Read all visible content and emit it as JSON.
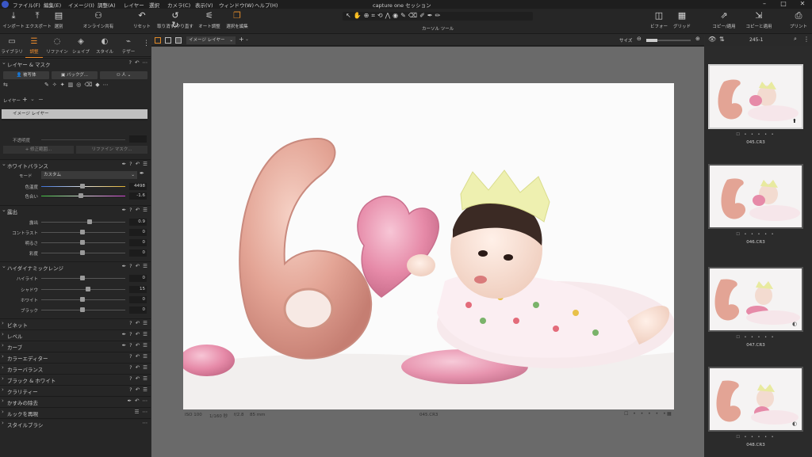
{
  "menubar": {
    "items": [
      "ファイル(F)",
      "編集(E)",
      "イメージ(I)",
      "調整(A)",
      "レイヤー",
      "選択",
      "カメラ(C)",
      "表示(V)",
      "ウィンドウ(W)",
      "ヘルプ(H)"
    ],
    "window_title": "capture one セッション"
  },
  "toolbar": {
    "left": [
      {
        "label": "インポート",
        "icon": "import-icon"
      },
      {
        "label": "エクスポート",
        "icon": "export-icon"
      },
      {
        "label": "選別",
        "icon": "cull-icon"
      },
      {
        "label": "オンライン共有",
        "icon": "share-icon"
      },
      {
        "label": "リセット",
        "icon": "reset-icon"
      },
      {
        "label": "取り消す/やり直す",
        "icon": "undo-icon"
      },
      {
        "label": "オート調整",
        "icon": "auto-adjust-icon"
      },
      {
        "label": "選択を編集",
        "icon": "edit-selection-icon"
      }
    ],
    "cursor_tools_label": "カーソル ツール",
    "right": [
      {
        "label": "ビフォー",
        "icon": "before-icon"
      },
      {
        "label": "グリッド",
        "icon": "grid-icon"
      },
      {
        "label": "コピー/適用",
        "icon": "copy-apply-icon"
      },
      {
        "label": "コピーと適用",
        "icon": "copy-and-apply-icon"
      },
      {
        "label": "プリント",
        "icon": "print-icon"
      }
    ]
  },
  "tabs": [
    {
      "label": "ライブラリ",
      "icon": "library-icon"
    },
    {
      "label": "調整",
      "icon": "adjust-icon"
    },
    {
      "label": "リファイン",
      "icon": "refine-icon"
    },
    {
      "label": "シェイプ",
      "icon": "shape-icon"
    },
    {
      "label": "スタイル",
      "icon": "style-icon"
    },
    {
      "label": "テザー",
      "icon": "tether-icon"
    }
  ],
  "layers": {
    "title": "レイヤー & マスク",
    "subject_btn": "被写体",
    "background_btn": "バックグ...",
    "people_btn": "人",
    "layer_label": "レイヤー",
    "layer_item": "イメージ レイヤー",
    "opacity_label": "不透明度",
    "refine_range_btn": "修正範囲...",
    "refine_mask_btn": "リファイン マスク..."
  },
  "white_balance": {
    "title": "ホワイトバランス",
    "mode_label": "モード",
    "mode_value": "カスタム",
    "sliders": [
      {
        "label": "色温度",
        "value": "4498",
        "pos": 0.49
      },
      {
        "label": "色合い",
        "value": "-1.6",
        "pos": 0.47
      }
    ]
  },
  "exposure": {
    "title": "露出",
    "sliders": [
      {
        "label": "露出",
        "value": "0.9",
        "pos": 0.58
      },
      {
        "label": "コントラスト",
        "value": "0",
        "pos": 0.49
      },
      {
        "label": "明るさ",
        "value": "0",
        "pos": 0.49
      },
      {
        "label": "彩度",
        "value": "0",
        "pos": 0.49
      }
    ]
  },
  "hdr": {
    "title": "ハイダイナミックレンジ",
    "sliders": [
      {
        "label": "ハイライト",
        "value": "0",
        "pos": 0.49
      },
      {
        "label": "シャドウ",
        "value": "15",
        "pos": 0.56
      },
      {
        "label": "ホワイト",
        "value": "0",
        "pos": 0.49
      },
      {
        "label": "ブラック",
        "value": "0",
        "pos": 0.49
      }
    ]
  },
  "collapsed_sections": [
    "ビネット",
    "レベル",
    "カーブ",
    "カラーエディター",
    "カラーバランス",
    "ブラック & ホワイト",
    "クラリティー",
    "かすみの除去",
    "ルックを再現",
    "スタイルブラシ"
  ],
  "viewer": {
    "layer_dropdown": "イメージ レイヤー",
    "size_label": "サイズ",
    "iso": "ISO 100",
    "shutter": "1/160 秒",
    "aperture": "f/2.8",
    "focal": "85 mm",
    "filename": "045.CR3"
  },
  "browser": {
    "count": "245-1",
    "thumbs": [
      "045.CR3",
      "046.CR3",
      "047.CR3",
      "048.CR3"
    ]
  }
}
